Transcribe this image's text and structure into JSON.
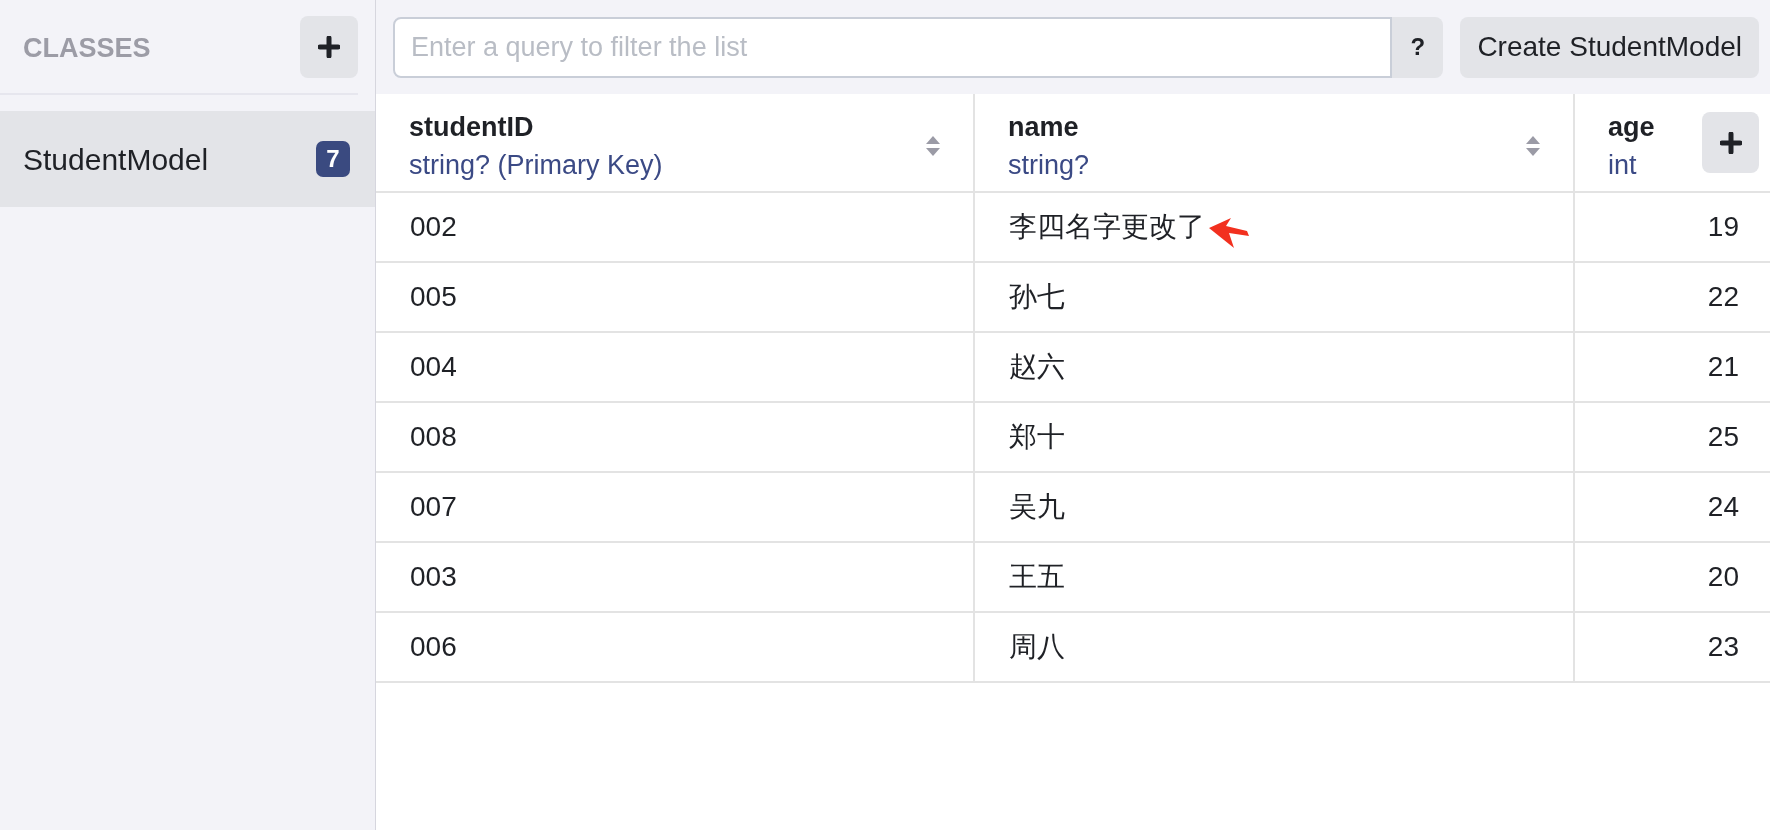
{
  "sidebar": {
    "heading": "CLASSES",
    "items": [
      {
        "name": "StudentModel",
        "count": "7",
        "selected": true
      }
    ]
  },
  "toolbar": {
    "search": {
      "placeholder": "Enter a query to filter the list"
    },
    "help_button": "?",
    "create_button": "Create StudentModel"
  },
  "table": {
    "columns": [
      {
        "name": "studentID",
        "type": "string? (Primary Key)",
        "sortable": true,
        "kind": "text"
      },
      {
        "name": "name",
        "type": "string?",
        "sortable": true,
        "kind": "text"
      },
      {
        "name": "age",
        "type": "int",
        "sortable": false,
        "kind": "number"
      }
    ],
    "rows": [
      {
        "cells": [
          {
            "text": "002",
            "marked": false
          },
          {
            "text": "李四名字更改了",
            "marked": true
          },
          {
            "text": "19",
            "marked": false
          }
        ]
      },
      {
        "cells": [
          {
            "text": "005",
            "marked": false
          },
          {
            "text": "孙七",
            "marked": false
          },
          {
            "text": "22",
            "marked": false
          }
        ]
      },
      {
        "cells": [
          {
            "text": "004",
            "marked": false
          },
          {
            "text": "赵六",
            "marked": false
          },
          {
            "text": "21",
            "marked": false
          }
        ]
      },
      {
        "cells": [
          {
            "text": "008",
            "marked": false
          },
          {
            "text": "郑十",
            "marked": false
          },
          {
            "text": "25",
            "marked": false
          }
        ]
      },
      {
        "cells": [
          {
            "text": "007",
            "marked": false
          },
          {
            "text": "吴九",
            "marked": false
          },
          {
            "text": "24",
            "marked": false
          }
        ]
      },
      {
        "cells": [
          {
            "text": "003",
            "marked": false
          },
          {
            "text": "王五",
            "marked": false
          },
          {
            "text": "20",
            "marked": false
          }
        ]
      },
      {
        "cells": [
          {
            "text": "006",
            "marked": false
          },
          {
            "text": "周八",
            "marked": false
          },
          {
            "text": "23",
            "marked": false
          }
        ]
      }
    ]
  }
}
